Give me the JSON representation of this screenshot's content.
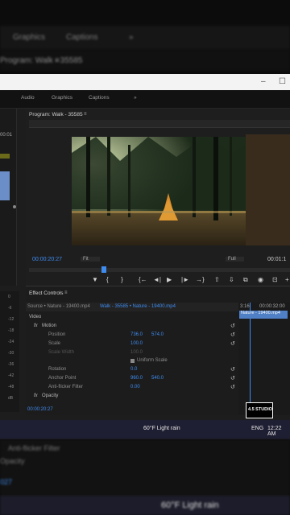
{
  "bg_top": {
    "tab_graphics": "Graphics",
    "tab_captions": "Captions",
    "more": "»",
    "program_title": "Program: Walk - 35585",
    "menu": "≡"
  },
  "window": {
    "minimize": "–",
    "maximize": "☐"
  },
  "workspace": {
    "audio": "Audio",
    "graphics": "Graphics",
    "captions": "Captions",
    "more": "»"
  },
  "monitor": {
    "title": "Program: Walk - 35585",
    "menu": "≡",
    "timecode_left": "00:00:20:27",
    "fit": "Fit",
    "full": "Full",
    "timecode_right": "00:01:1",
    "left_tc": "00:01"
  },
  "transport": {
    "marker": "▼",
    "in": "{",
    "out": "}",
    "step_back_edit": "{←",
    "step_back": "◄|",
    "play": "▶",
    "step_fwd": "|►",
    "step_fwd_edit": "→}",
    "lift": "⇧",
    "extract": "⇩",
    "export": "⧉",
    "camera": "◉",
    "compare": "⊡",
    "add": "+"
  },
  "effects": {
    "tab_title": "Effect Controls",
    "tab_menu": "≡",
    "source": "Source • Nature - 19400.mp4",
    "sequence": "Walk - 35585 • Nature - 19400.mp4",
    "tl_start": "3:16",
    "tl_end": "00:00:32:00",
    "clip_name": "Nature - 19400.mp4",
    "video_label": "Video",
    "motion": "Motion",
    "position_label": "Position",
    "position_x": "736.0",
    "position_y": "574.0",
    "scale_label": "Scale",
    "scale_val": "100.0",
    "scale_width_label": "Scale Width",
    "scale_width_val": "100.0",
    "uniform_scale": "Uniform Scale",
    "rotation_label": "Rotation",
    "rotation_val": "0.0",
    "anchor_label": "Anchor Point",
    "anchor_x": "960.0",
    "anchor_y": "540.0",
    "flicker_label": "Anti-flicker Filter",
    "flicker_val": "0.00",
    "opacity_label": "Opacity",
    "fx": "fx",
    "reset_icon": "↺",
    "bottom_tc": "00:00:20:27"
  },
  "meter_ticks": [
    "0",
    "-6",
    "-12",
    "-18",
    "-24",
    "-30",
    "-36",
    "-42",
    "-48",
    "dB"
  ],
  "taskbar": {
    "weather": "60°F  Light rain",
    "lang": "ENG",
    "time": "12:22 AM",
    "watermark": "4.5 STUDIO"
  },
  "bottom_bg": {
    "flicker": "Anti-flicker Filter",
    "opacity": "Opacity",
    "tc": "027",
    "weather": "60°F  Light rain"
  }
}
